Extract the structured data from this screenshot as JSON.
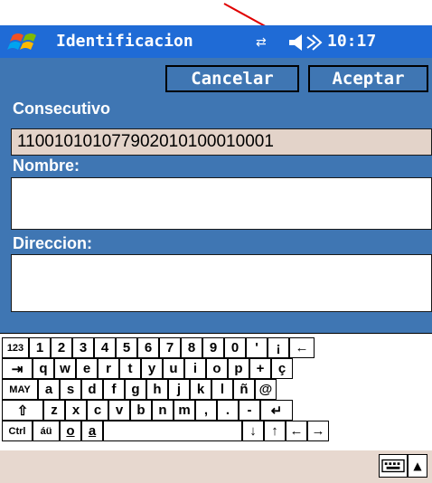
{
  "titlebar": {
    "title": "Identificacion",
    "clock": "10:17",
    "icons": [
      "windows-logo-icon",
      "connectivity-icon",
      "volume-icon"
    ]
  },
  "toolbar": {
    "cancel_label": "Cancelar",
    "accept_label": "Aceptar"
  },
  "form": {
    "consecutivo_label": "Consecutivo",
    "consecutivo_value": "110010101077902010100010001",
    "nombre_label": "Nombre:",
    "nombre_value": "",
    "direccion_label": "Direccion:",
    "direccion_value": ""
  },
  "keyboard": {
    "rows": [
      [
        "123",
        "1",
        "2",
        "3",
        "4",
        "5",
        "6",
        "7",
        "8",
        "9",
        "0",
        "'",
        "¡",
        "←"
      ],
      [
        "⇥",
        "q",
        "w",
        "e",
        "r",
        "t",
        "y",
        "u",
        "i",
        "o",
        "p",
        "+",
        "ç"
      ],
      [
        "MAY",
        "a",
        "s",
        "d",
        "f",
        "g",
        "h",
        "j",
        "k",
        "l",
        "ñ",
        "@"
      ],
      [
        "⇧",
        "z",
        "x",
        "c",
        "v",
        "b",
        "n",
        "m",
        ",",
        ".",
        "-",
        "↵"
      ],
      [
        "Ctrl",
        "áü",
        "o",
        "a",
        " ",
        "↓",
        "↑",
        "←",
        "→"
      ]
    ]
  },
  "colors": {
    "title_bar": "#1f6bd6",
    "form_bg": "#3f76b3",
    "field_highlight": "#e3d3c9",
    "bottom_bar": "#e7d8cf",
    "annotation_arrow": "#e00000"
  }
}
